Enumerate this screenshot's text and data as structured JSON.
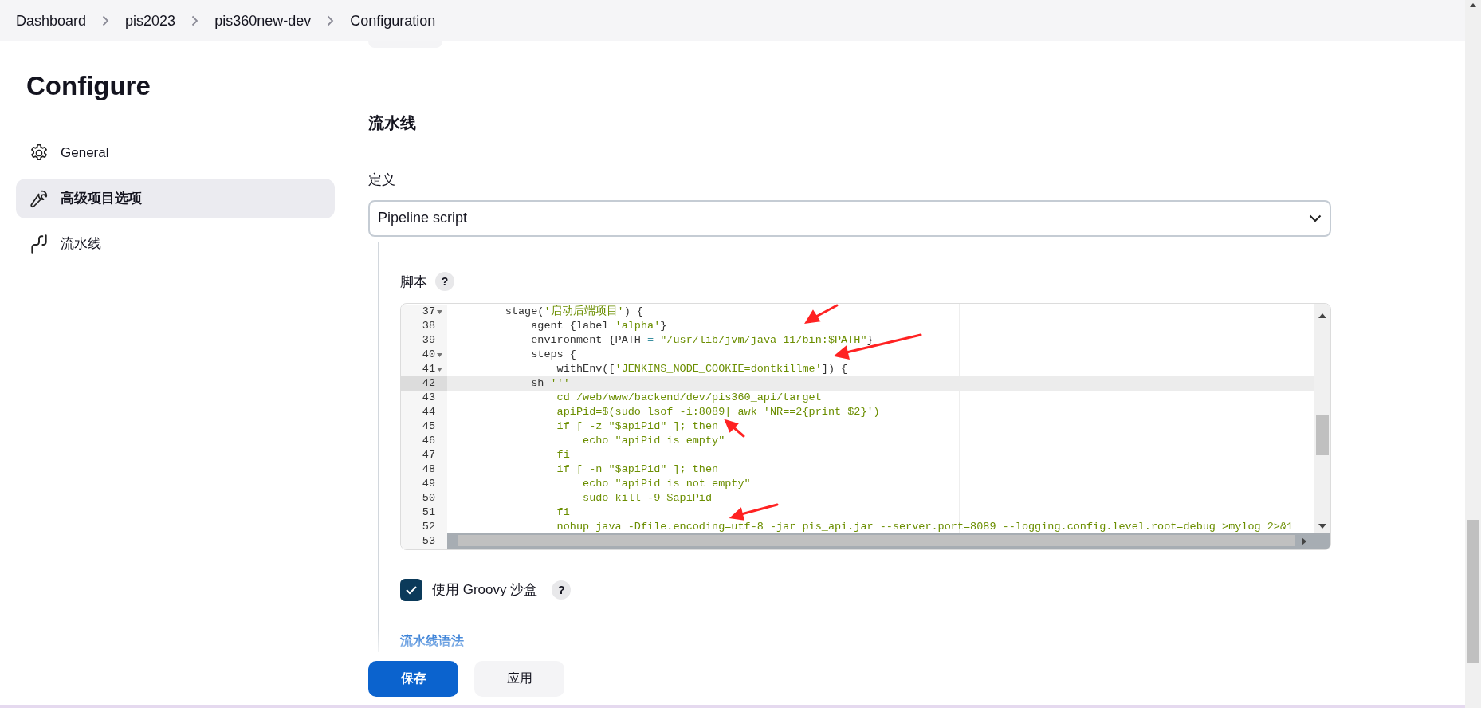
{
  "breadcrumbs": [
    {
      "label": "Dashboard"
    },
    {
      "label": "pis2023"
    },
    {
      "label": "pis360new-dev"
    },
    {
      "label": "Configuration"
    }
  ],
  "page_title": "Configure",
  "sidebar": {
    "items": [
      {
        "label": "General",
        "selected": false
      },
      {
        "label": "高级项目选项",
        "selected": true
      },
      {
        "label": "流水线",
        "selected": false
      }
    ]
  },
  "section": {
    "heading": "流水线",
    "definition": {
      "label": "定义",
      "value": "Pipeline script"
    },
    "script": {
      "label": "脚本",
      "help": "?",
      "lines": [
        {
          "number": "37",
          "foldable": true,
          "selected": false,
          "segments": [
            {
              "text": "        stage(",
              "kind": "plain"
            },
            {
              "text": "'启动后端项目'",
              "kind": "string"
            },
            {
              "text": ") {",
              "kind": "plain"
            }
          ]
        },
        {
          "number": "38",
          "foldable": false,
          "selected": false,
          "segments": [
            {
              "text": "            agent {label ",
              "kind": "plain"
            },
            {
              "text": "'alpha'",
              "kind": "string"
            },
            {
              "text": "}",
              "kind": "plain"
            }
          ]
        },
        {
          "number": "39",
          "foldable": false,
          "selected": false,
          "segments": [
            {
              "text": "            environment {PATH ",
              "kind": "plain"
            },
            {
              "text": "=",
              "kind": "operator"
            },
            {
              "text": " \"/usr/lib/jvm/java_11/bin:$PATH\"",
              "kind": "string"
            },
            {
              "text": "}",
              "kind": "plain"
            }
          ]
        },
        {
          "number": "40",
          "foldable": true,
          "selected": false,
          "segments": [
            {
              "text": "            steps {",
              "kind": "plain"
            }
          ]
        },
        {
          "number": "41",
          "foldable": true,
          "selected": false,
          "segments": [
            {
              "text": "                withEnv([",
              "kind": "plain"
            },
            {
              "text": "'JENKINS_NODE_COOKIE=dontkillme'",
              "kind": "string"
            },
            {
              "text": "]) {",
              "kind": "plain"
            }
          ]
        },
        {
          "number": "42",
          "foldable": false,
          "selected": true,
          "segments": [
            {
              "text": "            sh ",
              "kind": "plain"
            },
            {
              "text": "'''",
              "kind": "string"
            }
          ]
        },
        {
          "number": "43",
          "foldable": false,
          "selected": false,
          "segments": [
            {
              "text": "                cd /web/www/backend/dev/pis360_api/target",
              "kind": "string"
            }
          ]
        },
        {
          "number": "44",
          "foldable": false,
          "selected": false,
          "segments": [
            {
              "text": "                apiPid=$(sudo lsof -i:8089| awk 'NR==2{print $2}')",
              "kind": "string"
            }
          ]
        },
        {
          "number": "45",
          "foldable": false,
          "selected": false,
          "segments": [
            {
              "text": "                if [ -z \"$apiPid\" ]; then",
              "kind": "string"
            }
          ]
        },
        {
          "number": "46",
          "foldable": false,
          "selected": false,
          "segments": [
            {
              "text": "                    echo \"apiPid is empty\"",
              "kind": "string"
            }
          ]
        },
        {
          "number": "47",
          "foldable": false,
          "selected": false,
          "segments": [
            {
              "text": "                fi",
              "kind": "string"
            }
          ]
        },
        {
          "number": "48",
          "foldable": false,
          "selected": false,
          "segments": [
            {
              "text": "                if [ -n \"$apiPid\" ]; then",
              "kind": "string"
            }
          ]
        },
        {
          "number": "49",
          "foldable": false,
          "selected": false,
          "segments": [
            {
              "text": "                    echo \"apiPid is not empty\"",
              "kind": "string"
            }
          ]
        },
        {
          "number": "50",
          "foldable": false,
          "selected": false,
          "segments": [
            {
              "text": "                    sudo kill -9 $apiPid",
              "kind": "string"
            }
          ]
        },
        {
          "number": "51",
          "foldable": false,
          "selected": false,
          "segments": [
            {
              "text": "                fi",
              "kind": "string"
            }
          ]
        },
        {
          "number": "52",
          "foldable": false,
          "selected": false,
          "segments": [
            {
              "text": "                nohup java -Dfile.encoding=utf-8 -jar pis_api.jar --server.port=8089 --logging.config.level.root=debug >mylog 2>&1",
              "kind": "string"
            }
          ]
        },
        {
          "number": "53",
          "foldable": false,
          "selected": false
        }
      ]
    },
    "sandbox": {
      "label": "使用 Groovy 沙盒",
      "checked": true,
      "help": "?"
    },
    "syntax_link": "流水线语法"
  },
  "actions": [
    {
      "label": "保存",
      "kind": "primary"
    },
    {
      "label": "应用",
      "kind": "secondary"
    }
  ]
}
